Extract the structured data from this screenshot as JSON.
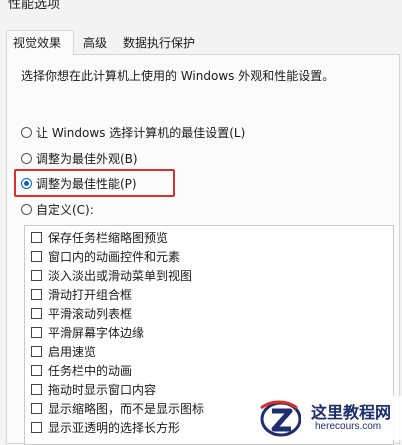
{
  "window": {
    "title": "性能选项"
  },
  "tabs": [
    {
      "label": "视觉效果",
      "active": true
    },
    {
      "label": "高级",
      "active": false
    },
    {
      "label": "数据执行保护",
      "active": false
    }
  ],
  "visual_effects": {
    "description": "选择你想在此计算机上使用的 Windows 外观和性能设置。",
    "options": [
      {
        "label": "让 Windows 选择计算机的最佳设置(L)",
        "checked": false
      },
      {
        "label": "调整为最佳外观(B)",
        "checked": false
      },
      {
        "label": "调整为最佳性能(P)",
        "checked": true
      },
      {
        "label": "自定义(C):",
        "checked": false
      }
    ],
    "highlight_color": "#d9302c",
    "accent_color": "#0067c0",
    "effects": [
      {
        "label": "保存任务栏缩略图预览",
        "checked": false
      },
      {
        "label": "窗口内的动画控件和元素",
        "checked": false
      },
      {
        "label": "淡入淡出或滑动菜单到视图",
        "checked": false
      },
      {
        "label": "滑动打开组合框",
        "checked": false
      },
      {
        "label": "平滑滚动列表框",
        "checked": false
      },
      {
        "label": "平滑屏幕字体边缘",
        "checked": false
      },
      {
        "label": "启用速览",
        "checked": false
      },
      {
        "label": "任务栏中的动画",
        "checked": false
      },
      {
        "label": "拖动时显示窗口内容",
        "checked": false
      },
      {
        "label": "显示缩略图，而不是显示图标",
        "checked": false
      },
      {
        "label": "显示亚透明的选择长方形",
        "checked": false
      }
    ]
  },
  "watermark": {
    "site_name": "这里教程网",
    "url": "herecours.com"
  }
}
